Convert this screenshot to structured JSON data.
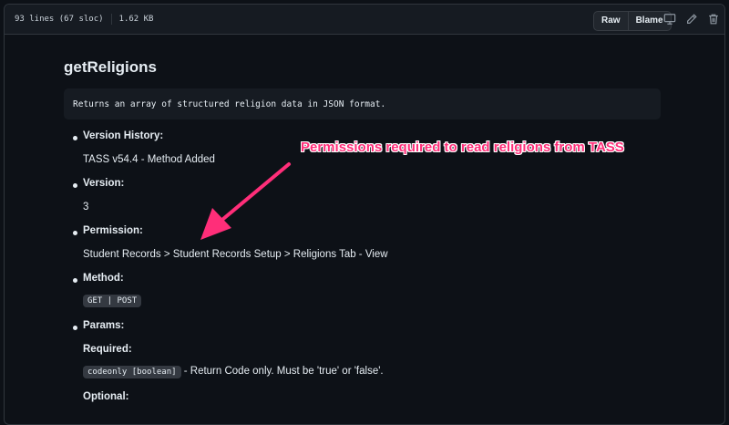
{
  "file_header": {
    "lines": "93 lines (67 sloc)",
    "size": "1.62 KB",
    "raw_label": "Raw",
    "blame_label": "Blame"
  },
  "doc": {
    "title": "getReligions",
    "description": "Returns an array of structured religion data in JSON format.",
    "version_history_label": "Version History:",
    "version_history_value": "TASS v54.4 - Method Added",
    "version_label": "Version:",
    "version_value": "3",
    "permission_label": "Permission:",
    "permission_value": "Student Records > Student Records Setup > Religions Tab - View",
    "method_label": "Method:",
    "method_value": "GET | POST",
    "params_label": "Params:",
    "required_label": "Required:",
    "required_code": "codeonly [boolean]",
    "required_desc": " - Return Code only. Must be 'true' or 'false'.",
    "optional_label": "Optional:"
  },
  "annotation": {
    "text": "Permissions required to read religions from TASS",
    "color": "#ff2e79"
  },
  "icons": [
    "desktop-icon",
    "pencil-icon",
    "trash-icon"
  ],
  "colors": {
    "background": "#0d1117",
    "header": "#161b22",
    "border": "#30363d"
  }
}
